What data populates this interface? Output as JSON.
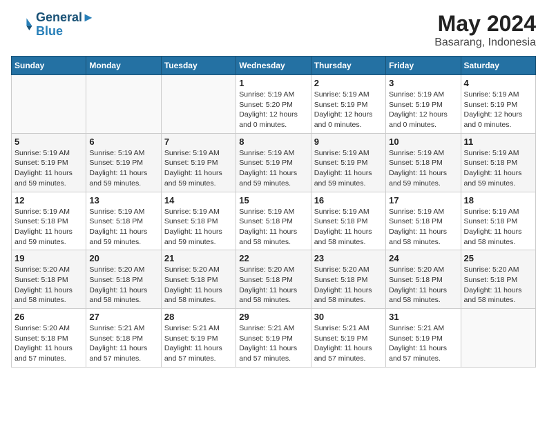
{
  "header": {
    "logo_line1": "General",
    "logo_line2": "Blue",
    "month_year": "May 2024",
    "location": "Basarang, Indonesia"
  },
  "days_of_week": [
    "Sunday",
    "Monday",
    "Tuesday",
    "Wednesday",
    "Thursday",
    "Friday",
    "Saturday"
  ],
  "weeks": [
    [
      {
        "day": "",
        "info": ""
      },
      {
        "day": "",
        "info": ""
      },
      {
        "day": "",
        "info": ""
      },
      {
        "day": "1",
        "sunrise": "Sunrise: 5:19 AM",
        "sunset": "Sunset: 5:20 PM",
        "daylight": "Daylight: 12 hours and 0 minutes."
      },
      {
        "day": "2",
        "sunrise": "Sunrise: 5:19 AM",
        "sunset": "Sunset: 5:19 PM",
        "daylight": "Daylight: 12 hours and 0 minutes."
      },
      {
        "day": "3",
        "sunrise": "Sunrise: 5:19 AM",
        "sunset": "Sunset: 5:19 PM",
        "daylight": "Daylight: 12 hours and 0 minutes."
      },
      {
        "day": "4",
        "sunrise": "Sunrise: 5:19 AM",
        "sunset": "Sunset: 5:19 PM",
        "daylight": "Daylight: 12 hours and 0 minutes."
      }
    ],
    [
      {
        "day": "5",
        "sunrise": "Sunrise: 5:19 AM",
        "sunset": "Sunset: 5:19 PM",
        "daylight": "Daylight: 11 hours and 59 minutes."
      },
      {
        "day": "6",
        "sunrise": "Sunrise: 5:19 AM",
        "sunset": "Sunset: 5:19 PM",
        "daylight": "Daylight: 11 hours and 59 minutes."
      },
      {
        "day": "7",
        "sunrise": "Sunrise: 5:19 AM",
        "sunset": "Sunset: 5:19 PM",
        "daylight": "Daylight: 11 hours and 59 minutes."
      },
      {
        "day": "8",
        "sunrise": "Sunrise: 5:19 AM",
        "sunset": "Sunset: 5:19 PM",
        "daylight": "Daylight: 11 hours and 59 minutes."
      },
      {
        "day": "9",
        "sunrise": "Sunrise: 5:19 AM",
        "sunset": "Sunset: 5:19 PM",
        "daylight": "Daylight: 11 hours and 59 minutes."
      },
      {
        "day": "10",
        "sunrise": "Sunrise: 5:19 AM",
        "sunset": "Sunset: 5:18 PM",
        "daylight": "Daylight: 11 hours and 59 minutes."
      },
      {
        "day": "11",
        "sunrise": "Sunrise: 5:19 AM",
        "sunset": "Sunset: 5:18 PM",
        "daylight": "Daylight: 11 hours and 59 minutes."
      }
    ],
    [
      {
        "day": "12",
        "sunrise": "Sunrise: 5:19 AM",
        "sunset": "Sunset: 5:18 PM",
        "daylight": "Daylight: 11 hours and 59 minutes."
      },
      {
        "day": "13",
        "sunrise": "Sunrise: 5:19 AM",
        "sunset": "Sunset: 5:18 PM",
        "daylight": "Daylight: 11 hours and 59 minutes."
      },
      {
        "day": "14",
        "sunrise": "Sunrise: 5:19 AM",
        "sunset": "Sunset: 5:18 PM",
        "daylight": "Daylight: 11 hours and 59 minutes."
      },
      {
        "day": "15",
        "sunrise": "Sunrise: 5:19 AM",
        "sunset": "Sunset: 5:18 PM",
        "daylight": "Daylight: 11 hours and 58 minutes."
      },
      {
        "day": "16",
        "sunrise": "Sunrise: 5:19 AM",
        "sunset": "Sunset: 5:18 PM",
        "daylight": "Daylight: 11 hours and 58 minutes."
      },
      {
        "day": "17",
        "sunrise": "Sunrise: 5:19 AM",
        "sunset": "Sunset: 5:18 PM",
        "daylight": "Daylight: 11 hours and 58 minutes."
      },
      {
        "day": "18",
        "sunrise": "Sunrise: 5:19 AM",
        "sunset": "Sunset: 5:18 PM",
        "daylight": "Daylight: 11 hours and 58 minutes."
      }
    ],
    [
      {
        "day": "19",
        "sunrise": "Sunrise: 5:20 AM",
        "sunset": "Sunset: 5:18 PM",
        "daylight": "Daylight: 11 hours and 58 minutes."
      },
      {
        "day": "20",
        "sunrise": "Sunrise: 5:20 AM",
        "sunset": "Sunset: 5:18 PM",
        "daylight": "Daylight: 11 hours and 58 minutes."
      },
      {
        "day": "21",
        "sunrise": "Sunrise: 5:20 AM",
        "sunset": "Sunset: 5:18 PM",
        "daylight": "Daylight: 11 hours and 58 minutes."
      },
      {
        "day": "22",
        "sunrise": "Sunrise: 5:20 AM",
        "sunset": "Sunset: 5:18 PM",
        "daylight": "Daylight: 11 hours and 58 minutes."
      },
      {
        "day": "23",
        "sunrise": "Sunrise: 5:20 AM",
        "sunset": "Sunset: 5:18 PM",
        "daylight": "Daylight: 11 hours and 58 minutes."
      },
      {
        "day": "24",
        "sunrise": "Sunrise: 5:20 AM",
        "sunset": "Sunset: 5:18 PM",
        "daylight": "Daylight: 11 hours and 58 minutes."
      },
      {
        "day": "25",
        "sunrise": "Sunrise: 5:20 AM",
        "sunset": "Sunset: 5:18 PM",
        "daylight": "Daylight: 11 hours and 58 minutes."
      }
    ],
    [
      {
        "day": "26",
        "sunrise": "Sunrise: 5:20 AM",
        "sunset": "Sunset: 5:18 PM",
        "daylight": "Daylight: 11 hours and 57 minutes."
      },
      {
        "day": "27",
        "sunrise": "Sunrise: 5:21 AM",
        "sunset": "Sunset: 5:18 PM",
        "daylight": "Daylight: 11 hours and 57 minutes."
      },
      {
        "day": "28",
        "sunrise": "Sunrise: 5:21 AM",
        "sunset": "Sunset: 5:19 PM",
        "daylight": "Daylight: 11 hours and 57 minutes."
      },
      {
        "day": "29",
        "sunrise": "Sunrise: 5:21 AM",
        "sunset": "Sunset: 5:19 PM",
        "daylight": "Daylight: 11 hours and 57 minutes."
      },
      {
        "day": "30",
        "sunrise": "Sunrise: 5:21 AM",
        "sunset": "Sunset: 5:19 PM",
        "daylight": "Daylight: 11 hours and 57 minutes."
      },
      {
        "day": "31",
        "sunrise": "Sunrise: 5:21 AM",
        "sunset": "Sunset: 5:19 PM",
        "daylight": "Daylight: 11 hours and 57 minutes."
      },
      {
        "day": "",
        "info": ""
      }
    ]
  ]
}
